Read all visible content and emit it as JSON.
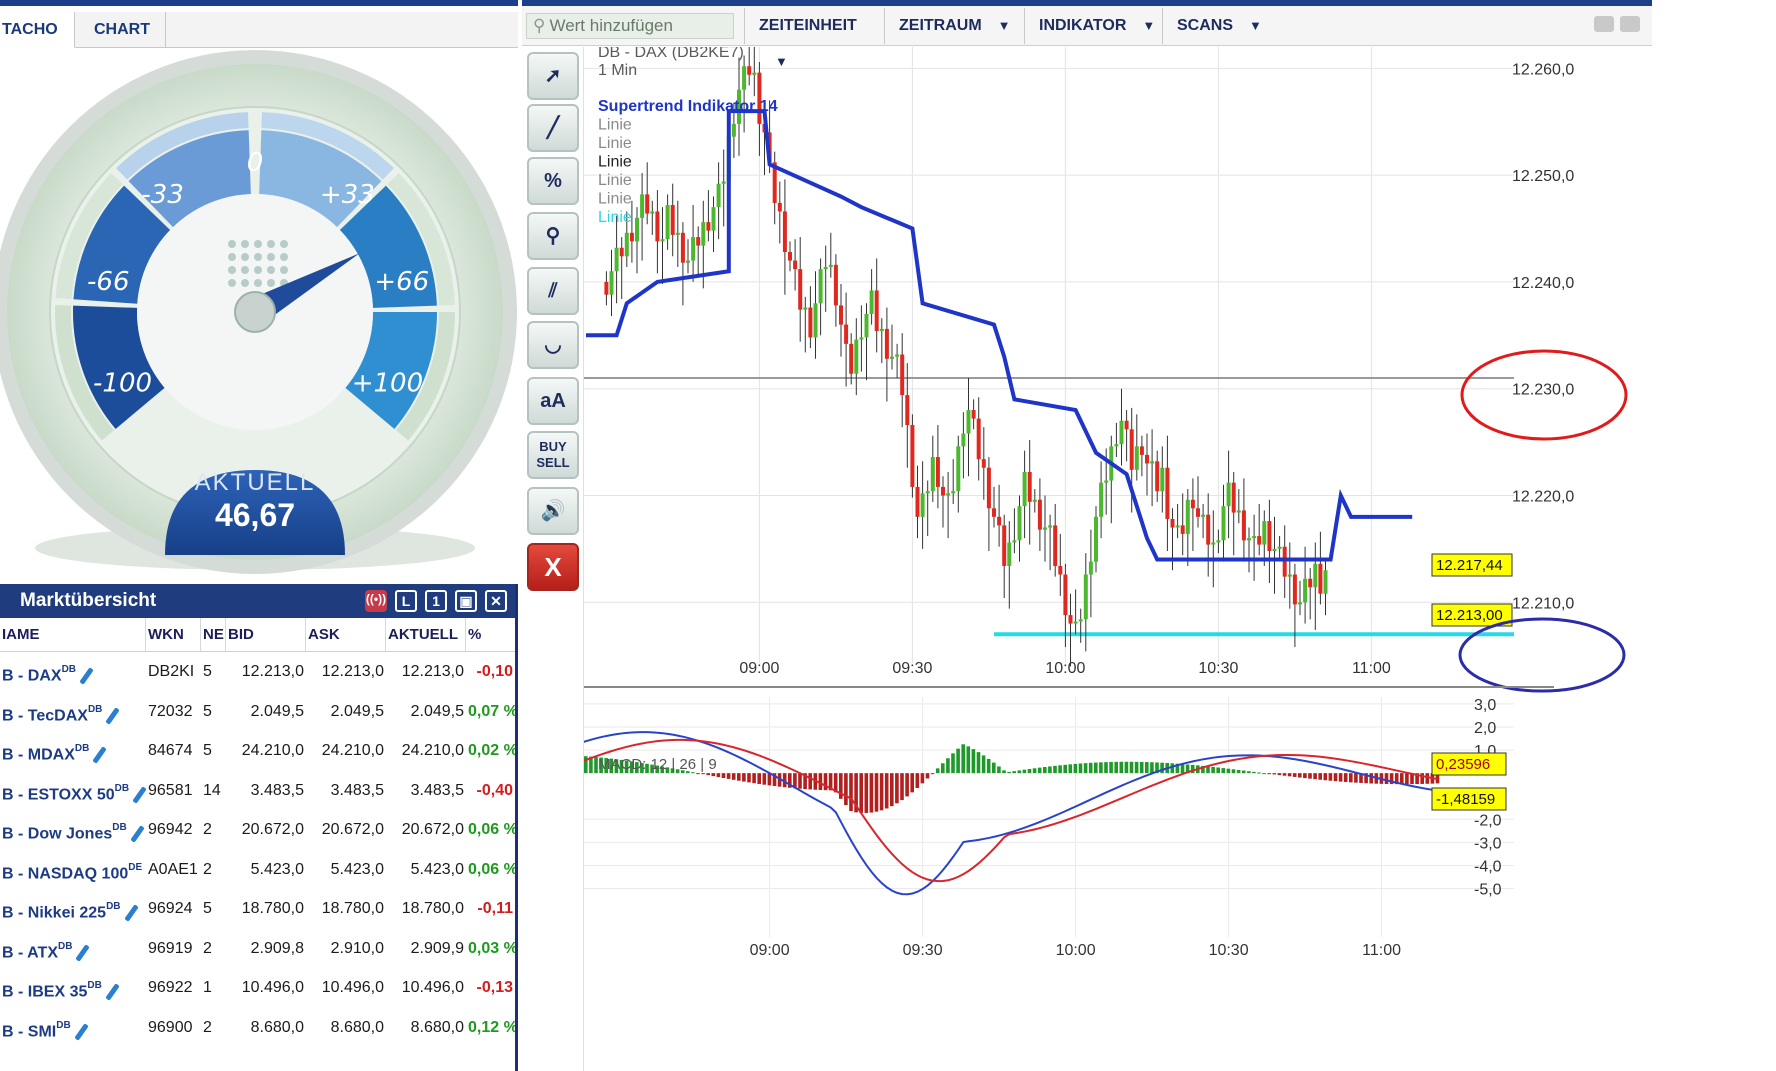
{
  "tabs": {
    "tacho": "TACHO",
    "chart": "CHART"
  },
  "gauge": {
    "labels": [
      "-100",
      "-66",
      "-33",
      "0",
      "+33",
      "+66",
      "+100"
    ],
    "current_label": "AKTUELL",
    "current_value": "46,67",
    "needle_value": 46.67
  },
  "market": {
    "title": "Marktübersicht",
    "columns": [
      "IAME",
      "WKN",
      "NE",
      "BID",
      "ASK",
      "AKTUELL",
      "%"
    ],
    "rows": [
      {
        "name": "B - DAX",
        "sup": "DB",
        "wkn": "DB2KI",
        "ne": "5",
        "bid": "12.213,0",
        "ask": "12.213,0",
        "akt": "12.213,0",
        "pct": "-0,10",
        "dir": "neg"
      },
      {
        "name": "B - TecDAX",
        "sup": "DB",
        "wkn": "72032",
        "ne": "5",
        "bid": "2.049,5",
        "ask": "2.049,5",
        "akt": "2.049,5",
        "pct": "0,07 %",
        "dir": "pos"
      },
      {
        "name": "B - MDAX",
        "sup": "DB",
        "wkn": "84674",
        "ne": "5",
        "bid": "24.210,0",
        "ask": "24.210,0",
        "akt": "24.210,0",
        "pct": "0,02 %",
        "dir": "pos"
      },
      {
        "name": "B - ESTOXX 50",
        "sup": "DB",
        "wkn": "96581",
        "ne": "14",
        "bid": "3.483,5",
        "ask": "3.483,5",
        "akt": "3.483,5",
        "pct": "-0,40",
        "dir": "neg"
      },
      {
        "name": "B - Dow Jones",
        "sup": "DB",
        "wkn": "96942",
        "ne": "2",
        "bid": "20.672,0",
        "ask": "20.672,0",
        "akt": "20.672,0",
        "pct": "0,06 %",
        "dir": "pos"
      },
      {
        "name": "B - NASDAQ 100",
        "sup": "DE",
        "wkn": "A0AE1",
        "ne": "2",
        "bid": "5.423,0",
        "ask": "5.423,0",
        "akt": "5.423,0",
        "pct": "0,06 %",
        "dir": "pos"
      },
      {
        "name": "B - Nikkei 225",
        "sup": "DB",
        "wkn": "96924",
        "ne": "5",
        "bid": "18.780,0",
        "ask": "18.780,0",
        "akt": "18.780,0",
        "pct": "-0,11",
        "dir": "neg"
      },
      {
        "name": "B - ATX",
        "sup": "DB",
        "wkn": "96919",
        "ne": "2",
        "bid": "2.909,8",
        "ask": "2.910,0",
        "akt": "2.909,9",
        "pct": "0,03 %",
        "dir": "pos"
      },
      {
        "name": "B - IBEX 35",
        "sup": "DB",
        "wkn": "96922",
        "ne": "1",
        "bid": "10.496,0",
        "ask": "10.496,0",
        "akt": "10.496,0",
        "pct": "-0,13",
        "dir": "neg"
      },
      {
        "name": "B - SMI",
        "sup": "DB",
        "wkn": "96900",
        "ne": "2",
        "bid": "8.680,0",
        "ask": "8.680,0",
        "akt": "8.680,0",
        "pct": "0,12 %",
        "dir": "pos"
      }
    ]
  },
  "topbar": {
    "search_placeholder": "Wert hinzufügen",
    "menus": [
      "ZEITEINHEIT",
      "ZEITRAUM",
      "INDIKATOR",
      "SCANS"
    ]
  },
  "tools": [
    "cursor-tool",
    "line-tool",
    "percent-tool",
    "zoom-tool",
    "parallel-tool",
    "curve-tool",
    "text-tool",
    "buy-sell-tool",
    "sound-tool",
    "close-tool"
  ],
  "tool_labels": {
    "percent": "%",
    "text": "aA",
    "buy": "BUY",
    "sell": "SELL",
    "close": "X"
  },
  "chart": {
    "title": "DB - DAX (DB2KE7)",
    "interval": "1 Min",
    "legend": [
      {
        "label": "Supertrend Indikator 14",
        "color": "#1f35c8"
      },
      {
        "label": "Linie",
        "color": "#8a8a8a"
      },
      {
        "label": "Linie",
        "color": "#8a8a8a"
      },
      {
        "label": "Linie",
        "color": "#222222"
      },
      {
        "label": "Linie",
        "color": "#8a8a8a"
      },
      {
        "label": "Linie",
        "color": "#8a8a8a"
      },
      {
        "label": "Linie",
        "color": "#27d9e6"
      }
    ],
    "y_ticks": [
      "12.260,0",
      "12.250,0",
      "12.240,0",
      "12.230,0",
      "12.220,0",
      "12.210,0"
    ],
    "x_ticks": [
      "09:00",
      "09:30",
      "10:00",
      "10:30",
      "11:00"
    ],
    "supertrend_value": "12.217,44",
    "last_price": "12.213,00",
    "macd_label": "MACD: 12 | 26 | 9",
    "macd_ticks": [
      "3,0",
      "2,0",
      "1,0",
      "-2,0",
      "-3,0",
      "-4,0",
      "-5,0"
    ],
    "macd_value_1": "0,23596",
    "macd_value_2": "-1,48159"
  },
  "chart_data": {
    "type": "candlestick",
    "title": "DB - DAX (DB2KE7)",
    "x_ticks": [
      "09:00",
      "09:30",
      "10:00",
      "10:30",
      "11:00"
    ],
    "y_range": [
      12203,
      12262
    ],
    "supertrend": [
      [
        0,
        12235
      ],
      [
        6,
        12235
      ],
      [
        8,
        12238
      ],
      [
        14,
        12240
      ],
      [
        28,
        12241
      ],
      [
        28,
        12256
      ],
      [
        35,
        12256
      ],
      [
        36,
        12251
      ],
      [
        50,
        12248
      ],
      [
        54,
        12247
      ],
      [
        64,
        12245
      ],
      [
        66,
        12238
      ],
      [
        80,
        12236
      ],
      [
        82,
        12233
      ],
      [
        84,
        12229
      ],
      [
        96,
        12228
      ],
      [
        100,
        12224
      ],
      [
        106,
        12222
      ],
      [
        108,
        12219
      ],
      [
        110,
        12216
      ],
      [
        112,
        12214
      ],
      [
        140,
        12214
      ],
      [
        146,
        12214
      ],
      [
        148,
        12220
      ],
      [
        150,
        12218
      ],
      [
        162,
        12218
      ]
    ],
    "reference_lines": [
      {
        "value": 12231,
        "color": "#999999"
      },
      {
        "value": 12207,
        "color": "#27d9e6"
      }
    ],
    "annotations": [
      {
        "value": 12231,
        "shape": "ellipse",
        "color": "#e01b1b"
      },
      {
        "value": 12207,
        "shape": "ellipse",
        "color": "#2c2ca8"
      }
    ],
    "macd": {
      "label": "MACD: 12 | 26 | 9",
      "range": [
        -5.8,
        3.3
      ],
      "last_signal": 0.23596,
      "last_macd": -1.48159
    }
  }
}
